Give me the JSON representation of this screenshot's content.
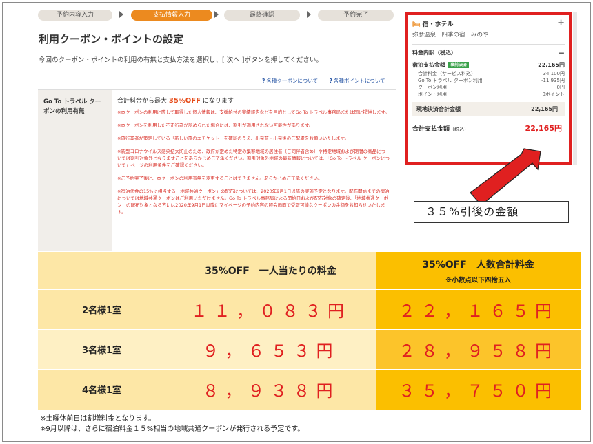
{
  "steps": [
    "予約内容入力",
    "支払情報入力",
    "最終確認",
    "予約完了"
  ],
  "page_title": "利用クーポン・ポイントの設定",
  "description": "今回のクーポン・ポイントの利用の有無と支払方法を選択し、[ 次へ ]ボタンを押してください。",
  "help_links": [
    "各種クーポンについて",
    "各種ポイントについて"
  ],
  "coupon": {
    "label": "Go To トラベル クーポンの利用有無",
    "main_text_prefix": "合計料金から最大 ",
    "main_text_highlight": "35%OFF",
    "main_text_suffix": " になります",
    "notes": [
      "※本クーポンの利用に際して取得した個人情報は、支援給付の実績報告などを目的としてGo To トラベル事務局または国に提供します。",
      "※本クーポンを利用した不正行為が認められた場合には、割引が適用されない可能性があります。",
      "※旅行業者が策定している「新しい旅のエチケット」を確認のうえ、出発前・出発後のご配慮をお願いいたします。",
      "※新型コロナウイルス感染拡大防止のため、政府が定めた特定の集客地域の居住者（ご同伴者含め）や特定地域および期間の商品については割引対象外となりますことをあらかじめご了承ください。割引対象外地域の最新情報については、「Go To トラベル クーポンについて」ページの利用条件をご確認ください。",
      "※ご予約完了後に、本クーポンの利用有無を変更することはできません。あらかじめご了承ください。",
      "※宿泊代金の15%に相当する「地域共通クーポン」の配布については、2020年9月1日以降の実施予定となります。配布開始までの宿泊については地域共通クーポンはご利用いただけません。Go To トラベル事務局による開始日および配布対象の確定後、「地域共通クーポン」の配布対象となる方には2020年9月1日以降にマイページの予約内容の照会画面で受取可能なクーポンの金額をお知らせいたします。"
    ]
  },
  "panel": {
    "category": "宿・ホテル",
    "hotel_name": "弥彦温泉　四季の宿　みのや",
    "breakdown_title": "料金内訳（税込）",
    "stay_total_label": "宿泊支払金額",
    "stay_total_badge": "事前決済",
    "stay_total_value": "22,165円",
    "items": [
      {
        "label": "合計料金（サービス料込）",
        "value": "34,100円"
      },
      {
        "label": "Go To トラベル クーポン利用",
        "value": "-11,935円"
      },
      {
        "label": "クーポン利用",
        "value": "0円"
      },
      {
        "label": "ポイント利用",
        "value": "0ポイント"
      }
    ],
    "local_label": "現地決済合計金額",
    "local_value": "22,165円",
    "grand_label": "合計支払金額",
    "grand_label_small": "（税込）",
    "grand_value": "22,165円"
  },
  "callout": "３５%引後の金額",
  "table": {
    "headers": [
      "",
      "35%OFF　一人当たりの料金",
      "35%OFF　人数合計料金"
    ],
    "header_note": "※小数点以下四捨五入",
    "rows": [
      {
        "label": "2名様1室",
        "per_person": "１１，０８３円",
        "total": "２２，１６５円"
      },
      {
        "label": "3名様1室",
        "per_person": "９，６５３円",
        "total": "２８，９５８円"
      },
      {
        "label": "4名様1室",
        "per_person": "８，９３８円",
        "total": "３５，７５０円"
      }
    ]
  },
  "footnotes": [
    "※土曜休前日は割増料金となります。",
    "※9月以降は、さらに宿泊料金１５%相当の地域共通クーポンが発行される予定です。"
  ],
  "colors": {
    "accent": "#ec8a1f",
    "highlight_red": "#e02020",
    "table_light": "#fde7a6",
    "table_dark": "#fbbf00"
  }
}
